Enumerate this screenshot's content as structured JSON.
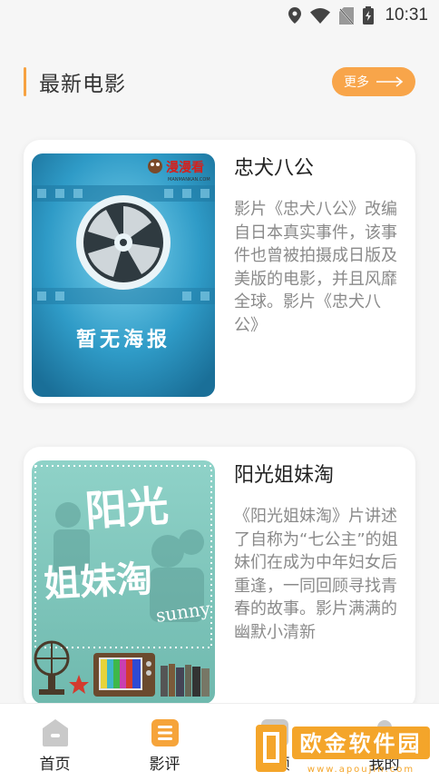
{
  "status_bar": {
    "time": "10:31"
  },
  "section": {
    "title": "最新电影",
    "more_label": "更多"
  },
  "movies": [
    {
      "title": "忠犬八公",
      "description": "影片《忠犬八公》改编自日本真实事件，该事件也曾被拍摄成日版及美版的电影，并且风靡全球。影片《忠犬八公》",
      "poster": {
        "caption": "暂无海报",
        "logo": "漫漫看",
        "logo_sub": "MANMANKAN.COM"
      }
    },
    {
      "title": "阳光姐妹淘",
      "description": "《阳光姐妹淘》片讲述了自称为“七公主”的姐妹们在成为中年妇女后重逢，一同回顾寻找青春的故事。影片满满的幽默小清新",
      "poster": {
        "title_line1": "阳光",
        "title_line2": "姐妹淘",
        "subtitle": "sunny"
      }
    }
  ],
  "nav": {
    "items": [
      {
        "label": "首页",
        "icon": "home-icon"
      },
      {
        "label": "影评",
        "icon": "list-icon"
      },
      {
        "label": "视频",
        "icon": "video-icon"
      },
      {
        "label": "我的",
        "icon": "person-icon"
      }
    ],
    "active_index": 1
  },
  "watermark": {
    "text": "欧金软件园",
    "url": "www.apoujin.com"
  },
  "colors": {
    "accent": "#f7a241",
    "more_bg": "#f8a54a",
    "nav_inactive": "#c9c9c9",
    "nav_active": "#f6a43a"
  }
}
